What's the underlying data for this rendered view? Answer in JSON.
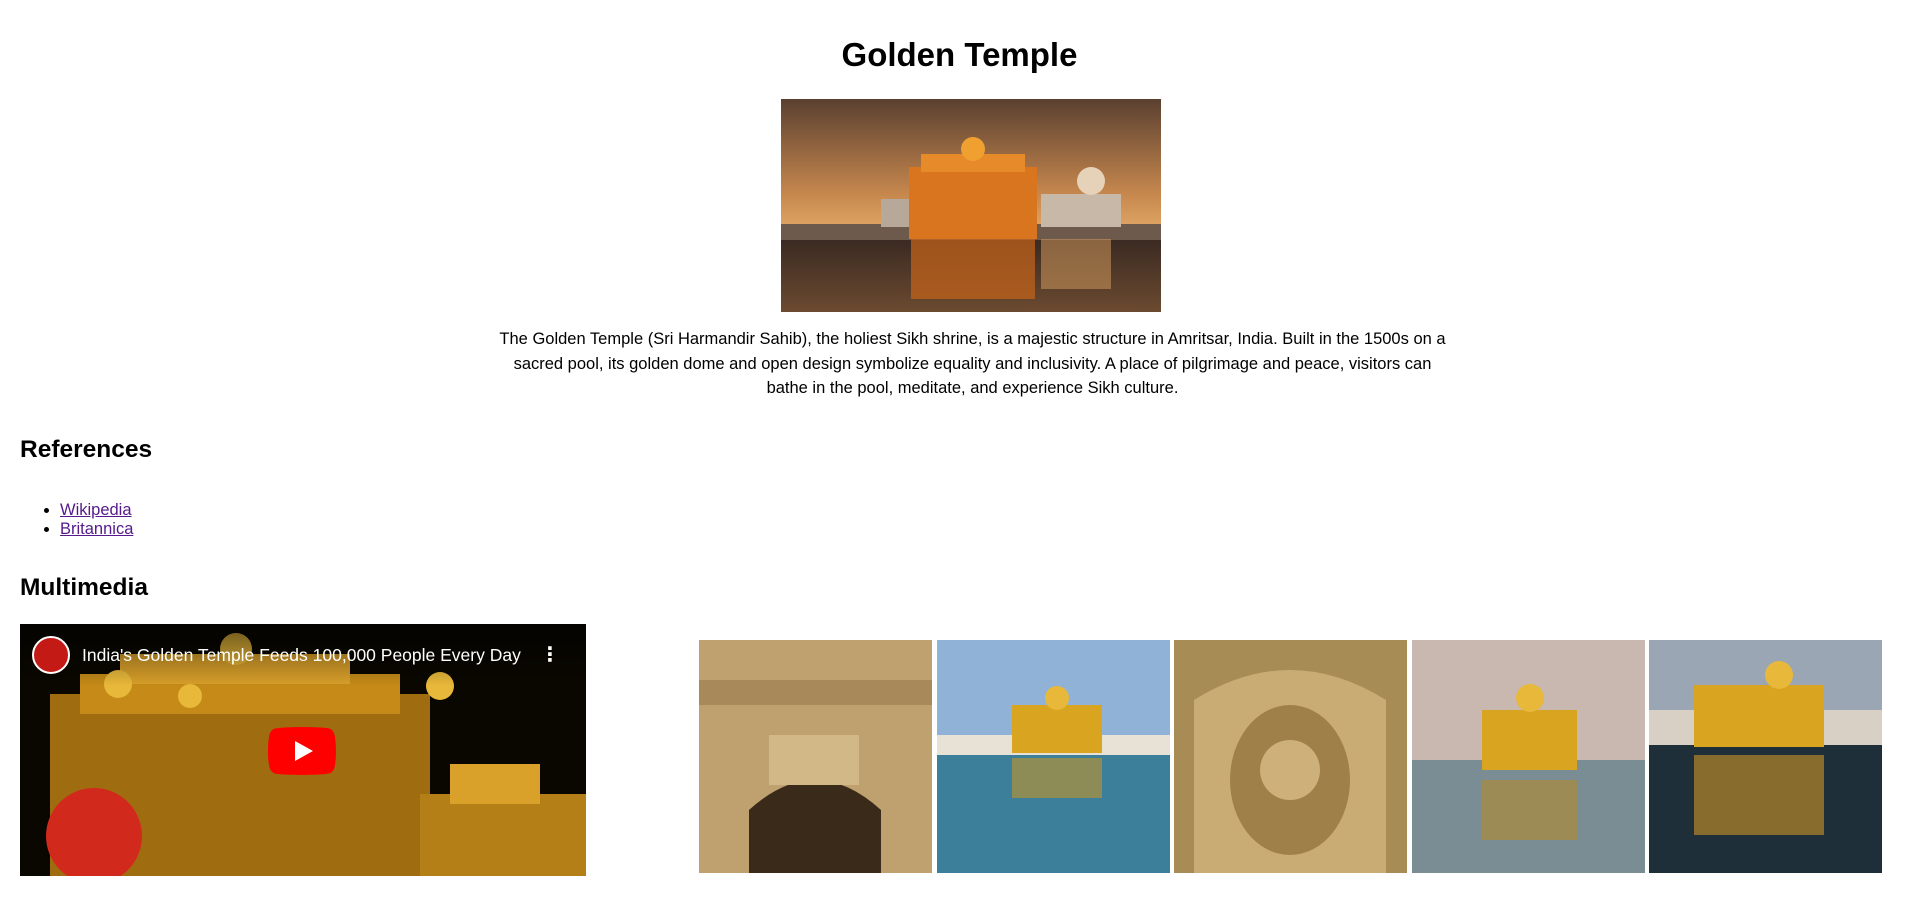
{
  "page": {
    "title": "Golden Temple",
    "description": "The Golden Temple (Sri Harmandir Sahib), the holiest Sikh shrine, is a majestic structure in Amritsar, India. Built in the 1500s on a sacred pool, its golden dome and open design symbolize equality and inclusivity. A place of pilgrimage and peace, visitors can bathe in the pool, meditate, and experience Sikh culture."
  },
  "references": {
    "heading": "References",
    "links": [
      {
        "label": "Wikipedia"
      },
      {
        "label": "Britannica"
      }
    ]
  },
  "multimedia": {
    "heading": "Multimedia",
    "video": {
      "title": "India's Golden Temple Feeds 100,000 People Every Day",
      "menu_icon": "more-vert-icon",
      "play_icon": "youtube-play-icon"
    },
    "gallery": [
      {
        "subject": "carved golden wall with arches"
      },
      {
        "subject": "golden temple by the pool under blue sky"
      },
      {
        "subject": "ornate golden floral relief panel"
      },
      {
        "subject": "golden temple at dusk with reflection"
      },
      {
        "subject": "golden temple across the water"
      }
    ]
  },
  "colors": {
    "link_visited": "#551a8b",
    "youtube_red": "#ff0000",
    "gold": "#d9a521"
  }
}
